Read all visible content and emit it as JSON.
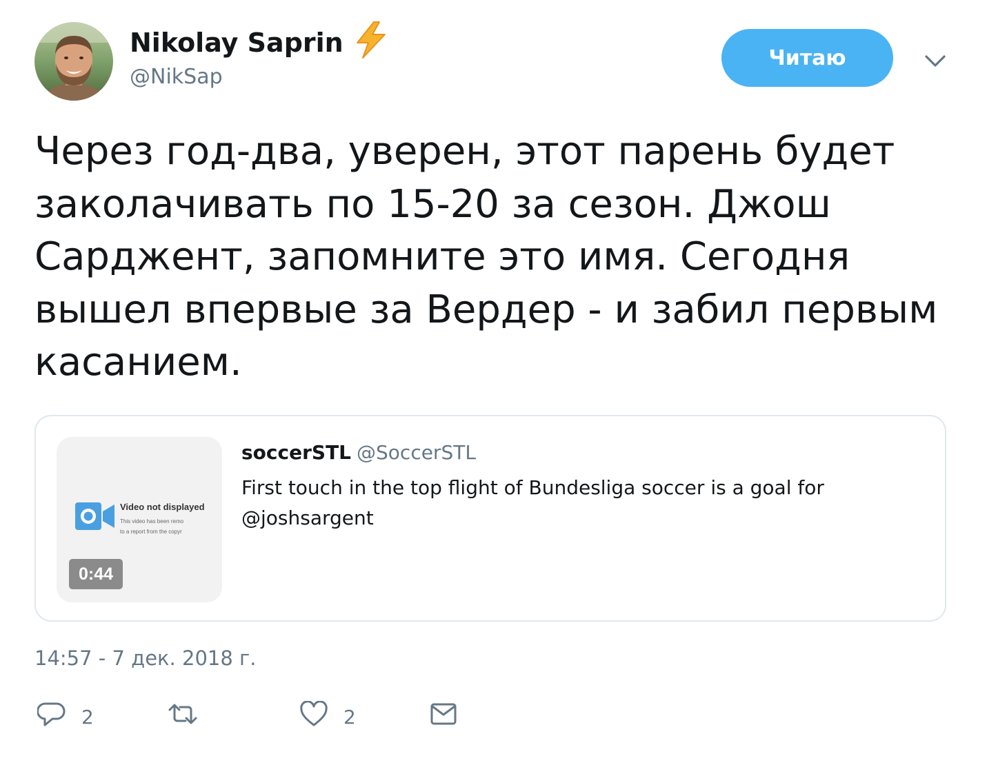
{
  "author": {
    "display_name": "Nikolay Saprin",
    "handle": "@NikSap",
    "emoji_icon": "high-voltage-emoji"
  },
  "follow_button": {
    "label": "Читаю",
    "color": "#4ab3f4"
  },
  "tweet": {
    "text": "Через год-два, уверен, этот парень будет заколачивать по 15-20 за сезон. Джош Сарджент, запомните это имя. Сегодня вышел впервые за Вердер - и забил первым касанием."
  },
  "quoted_tweet": {
    "display_name": "soccerSTL",
    "handle": "@SoccerSTL",
    "text_line1": "First touch in the top flight of Bundesliga soccer is a goal for",
    "text_line2": "@joshsargent",
    "media": {
      "notice_title": "Video not displayed",
      "notice_line1": "This video has been remo",
      "notice_line2": "to a report from the copyr",
      "duration": "0:44"
    }
  },
  "timestamp": "14:57 - 7 дек. 2018 г.",
  "actions": {
    "reply_count": "2",
    "like_count": "2"
  },
  "colors": {
    "text": "#14171a",
    "secondary": "#657786",
    "border": "#e1e8ed",
    "video_icon": "#4a9fe0"
  }
}
